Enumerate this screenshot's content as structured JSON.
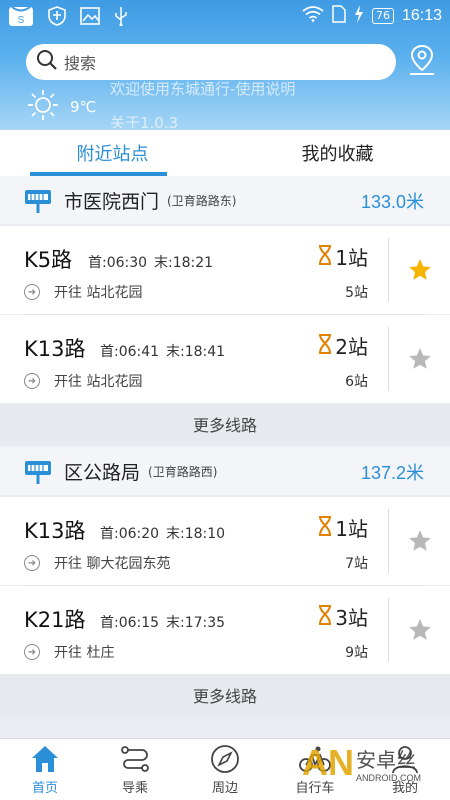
{
  "status_bar": {
    "battery": "76",
    "time": "16:13"
  },
  "search": {
    "placeholder": "搜索"
  },
  "weather": {
    "temperature": "9℃",
    "marquee_line1": "欢迎使用东城通行-使用说明",
    "marquee_line2": "关于1.0.3"
  },
  "tabs": [
    {
      "label": "附近站点",
      "active": true
    },
    {
      "label": "我的收藏",
      "active": false
    }
  ],
  "stations": [
    {
      "name": "市医院西门",
      "road": "(卫育路路东)",
      "distance": "133.0米",
      "routes": [
        {
          "name": "K5路",
          "first": "首:06:30",
          "last": "末:18:21",
          "direction": "开往 站北花园",
          "stops": "1站",
          "total": "5站",
          "favorited": true
        },
        {
          "name": "K13路",
          "first": "首:06:41",
          "last": "末:18:41",
          "direction": "开往 站北花园",
          "stops": "2站",
          "total": "6站",
          "favorited": false
        }
      ],
      "more": "更多线路"
    },
    {
      "name": "区公路局",
      "road": "(卫育路路西)",
      "distance": "137.2米",
      "routes": [
        {
          "name": "K13路",
          "first": "首:06:20",
          "last": "末:18:10",
          "direction": "开往 聊大花园东苑",
          "stops": "1站",
          "total": "7站",
          "favorited": false
        },
        {
          "name": "K21路",
          "first": "首:06:15",
          "last": "末:17:35",
          "direction": "开往 杜庄",
          "stops": "3站",
          "total": "9站",
          "favorited": false
        }
      ],
      "more": "更多线路"
    }
  ],
  "bottom_nav": [
    {
      "label": "首页",
      "icon": "home-icon",
      "active": true
    },
    {
      "label": "导乘",
      "icon": "route-icon",
      "active": false
    },
    {
      "label": "周边",
      "icon": "compass-icon",
      "active": false
    },
    {
      "label": "自行车",
      "icon": "bicycle-icon",
      "active": false
    },
    {
      "label": "我的",
      "icon": "user-icon",
      "active": false
    }
  ],
  "watermark": {
    "letters": "AN",
    "text": "安卓丝",
    "url": "ANDROID.COM"
  },
  "colors": {
    "accent": "#2b8fd8",
    "hourglass": "#e28200",
    "star_active": "#f5b400",
    "star_inactive": "#b8b8b8"
  }
}
